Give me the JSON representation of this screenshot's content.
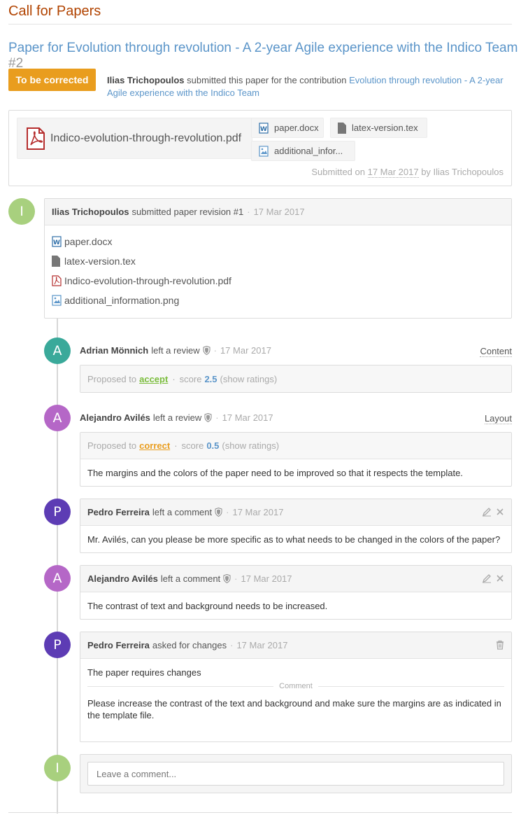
{
  "header": {
    "title": "Call for Papers"
  },
  "paper": {
    "title": "Paper for Evolution through revolution - A 2-year Agile experience with the Indico Team",
    "number": "#2",
    "state": "To be corrected",
    "submitter": "Ilias Trichopoulos",
    "submitted_text": " submitted this paper for the contribution ",
    "contribution": "Evolution through revolution - A 2-year Agile experience with the Indico Team"
  },
  "files": {
    "main": "Indico-evolution-through-revolution.pdf",
    "others": [
      "paper.docx",
      "latex-version.tex",
      "additional_infor..."
    ],
    "submitted_prefix": "Submitted on ",
    "submitted_date": "17 Mar 2017",
    "submitted_by": " by Ilias Trichopoulos"
  },
  "revision": {
    "initial": "I",
    "author": "Ilias Trichopoulos",
    "action": "submitted paper revision #1",
    "date": "17 Mar 2017",
    "files": [
      "paper.docx",
      "latex-version.tex",
      "Indico-evolution-through-revolution.pdf",
      "additional_information.png"
    ]
  },
  "timeline": {
    "review1": {
      "initial": "A",
      "author": "Adrian Mönnich",
      "action": "left a review",
      "date": "17 Mar 2017",
      "group": "Content",
      "proposed_label": "Proposed to",
      "verdict": "accept",
      "score_label": "score",
      "score": "2.5",
      "ratings_link": "(show ratings)"
    },
    "review2": {
      "initial": "A",
      "author": "Alejandro Avilés",
      "action": "left a review",
      "date": "17 Mar 2017",
      "group": "Layout",
      "proposed_label": "Proposed to",
      "verdict": "correct",
      "score_label": "score",
      "score": "0.5",
      "ratings_link": "(show ratings)",
      "comment": "The margins and the colors of the paper need to be improved so that it respects the template."
    },
    "comment1": {
      "initial": "P",
      "author": "Pedro Ferreira",
      "action": "left a comment",
      "date": "17 Mar 2017",
      "text": "Mr. Avilés, can you please be more specific as to what needs to be changed in the colors of the paper?"
    },
    "comment2": {
      "initial": "A",
      "author": "Alejandro Avilés",
      "action": "left a comment",
      "date": "17 Mar 2017",
      "text": "The contrast of text and background needs to be increased."
    },
    "judgment": {
      "initial": "P",
      "author": "Pedro Ferreira",
      "action": "asked for changes",
      "date": "17 Mar 2017",
      "text": "The paper requires changes",
      "divider": "Comment",
      "comment": "Please increase the contrast of the text and background and make sure the margins are as indicated in the template file."
    },
    "new_comment": {
      "initial": "I",
      "placeholder": "Leave a comment..."
    }
  },
  "colors": {
    "title": "#b14300",
    "link": "#5b95c9",
    "badge": "#e99d1e",
    "accept": "#7bbd3d",
    "correct": "#e99d1e",
    "avatar_green": "#a8d07e",
    "avatar_teal": "#3aa99a",
    "avatar_purple": "#b567c7",
    "avatar_indigo": "#5d3cb4"
  }
}
